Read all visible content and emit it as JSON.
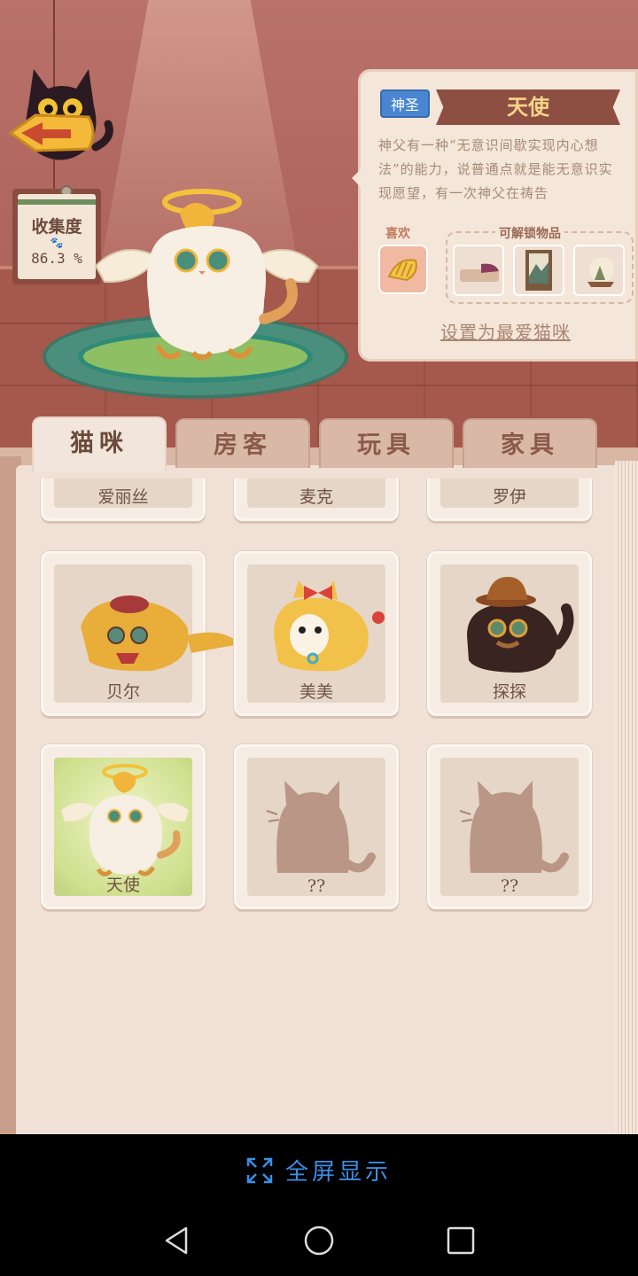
{
  "collection": {
    "title": "收集度",
    "value": "86.3 %"
  },
  "cat_info": {
    "tag": "神圣",
    "name": "天使",
    "description": "神父有一种“无意识间歇实现内心想法”的能力，说普通点就是能无意识实现愿望，有一次神父在祷告",
    "likes_label": "喜欢",
    "unlock_label": "可解锁物品",
    "set_favorite": "设置为最爱猫咪"
  },
  "tabs": [
    {
      "label": "猫咪",
      "active": true
    },
    {
      "label": "房客",
      "active": false
    },
    {
      "label": "玩具",
      "active": false
    },
    {
      "label": "家具",
      "active": false
    }
  ],
  "cats_top_row": [
    "爱丽丝",
    "麦克",
    "罗伊"
  ],
  "cats": [
    {
      "name": "贝尔",
      "unlocked": true,
      "selected": false
    },
    {
      "name": "美美",
      "unlocked": true,
      "selected": false
    },
    {
      "name": "探探",
      "unlocked": true,
      "selected": false
    },
    {
      "name": "天使",
      "unlocked": true,
      "selected": true
    },
    {
      "name": "??",
      "unlocked": false,
      "selected": false
    },
    {
      "name": "??",
      "unlocked": false,
      "selected": false
    }
  ],
  "system": {
    "fullscreen_label": "全屏显示"
  },
  "colors": {
    "accent_blue": "#3a8fe6",
    "tag_blue": "#4a86d0",
    "ribbon": "#8e4f43"
  }
}
